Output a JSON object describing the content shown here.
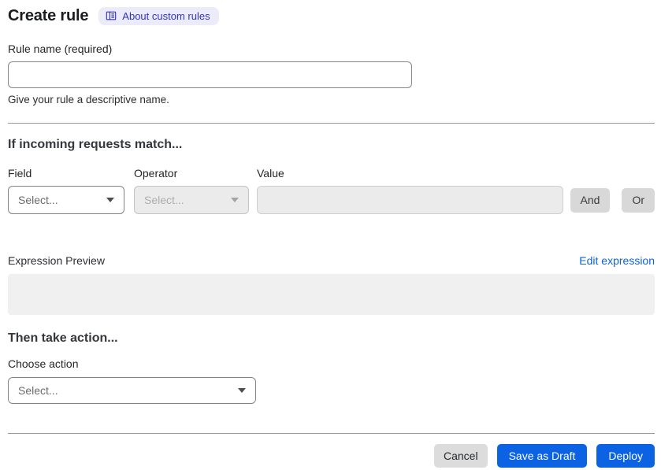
{
  "header": {
    "title": "Create rule",
    "about_badge": {
      "label": "About custom rules",
      "icon": "book-icon",
      "bg_color": "#ebebfa",
      "text_color": "#3434bd"
    }
  },
  "rule_name": {
    "label": "Rule name (required)",
    "value": "",
    "helper": "Give your rule a descriptive name."
  },
  "match_section": {
    "heading": "If incoming requests match...",
    "field": {
      "label": "Field",
      "selected_value": "Select...",
      "icon": "chevron-down-icon",
      "disabled": false
    },
    "operator": {
      "label": "Operator",
      "selected_value": "Select...",
      "icon": "chevron-down-icon",
      "disabled": true
    },
    "value": {
      "label": "Value",
      "value": "",
      "disabled": true
    },
    "and_button": "And",
    "or_button": "Or"
  },
  "expression": {
    "label": "Expression Preview",
    "edit_link": "Edit expression",
    "content": ""
  },
  "action_section": {
    "heading": "Then take action...",
    "choose_label": "Choose action",
    "select": {
      "selected_value": "Select...",
      "icon": "chevron-down-icon",
      "disabled": false
    }
  },
  "footer": {
    "cancel_label": "Cancel",
    "save_draft_label": "Save as Draft",
    "deploy_label": "Deploy"
  },
  "colors": {
    "primary_blue": "#0b63e4",
    "link_blue": "#0b63da",
    "divider_gray": "#98989c",
    "disabled_bg": "#ebebeb",
    "chip_gray": "#d8d8d8"
  }
}
